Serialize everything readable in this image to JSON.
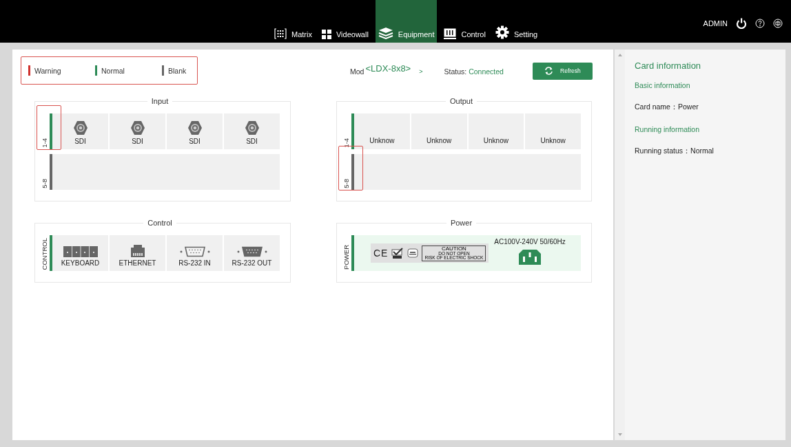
{
  "header": {
    "nav": [
      {
        "label": "Matrix",
        "selected": false
      },
      {
        "label": "Videowall",
        "selected": false
      },
      {
        "label": "Equipment",
        "selected": true
      },
      {
        "label": "Control",
        "selected": false
      },
      {
        "label": "Setting",
        "selected": false
      }
    ],
    "user": "ADMIN"
  },
  "legend": {
    "highlighted": true,
    "items": [
      {
        "label": "Warning",
        "color": "#d0312d"
      },
      {
        "label": "Normal",
        "color": "#2e8b57"
      },
      {
        "label": "Blank",
        "color": "#666666"
      }
    ]
  },
  "model": {
    "label": "Mod",
    "value": "<LDX-8x8>",
    "arrow": ">"
  },
  "status": {
    "label": "Status:",
    "value": "Connected"
  },
  "refresh_button": "Refresh",
  "groups": [
    {
      "title": "Input",
      "kind": "ports",
      "slots": [
        {
          "label": "1-4",
          "color": "#2e8b57",
          "highlighted": true,
          "ports": [
            {
              "label": "SDI",
              "kind": "sdi"
            },
            {
              "label": "SDI",
              "kind": "sdi"
            },
            {
              "label": "SDI",
              "kind": "sdi"
            },
            {
              "label": "SDI",
              "kind": "sdi"
            }
          ]
        },
        {
          "label": "5-8",
          "color": "#666666",
          "highlighted": false
        }
      ]
    },
    {
      "title": "Output",
      "kind": "ports",
      "slots": [
        {
          "label": "1-4",
          "color": "#2e8b57",
          "highlighted": false,
          "ports": [
            {
              "label": "Unknow",
              "kind": "text"
            },
            {
              "label": "Unknow",
              "kind": "text"
            },
            {
              "label": "Unknow",
              "kind": "text"
            },
            {
              "label": "Unknow",
              "kind": "text"
            }
          ]
        },
        {
          "label": "5-8",
          "color": "#666666",
          "highlighted": true
        }
      ]
    },
    {
      "title": "Control",
      "kind": "ports",
      "slots": [
        {
          "label": "CONTROL",
          "color": "#2e8b57",
          "highlighted": false,
          "ports": [
            {
              "label": "KEYBOARD",
              "kind": "keyboard"
            },
            {
              "label": "ETHERNET",
              "kind": "ethernet"
            },
            {
              "label": "RS-232 IN",
              "kind": "rs232-in"
            },
            {
              "label": "RS-232 OUT",
              "kind": "rs232-out"
            }
          ]
        }
      ]
    },
    {
      "title": "Power",
      "kind": "power",
      "slots": [
        {
          "label": "POWER",
          "color": "#2e8b57",
          "highlighted": false,
          "mark": "CE",
          "caution": [
            "CAUTION",
            "DO NOT OPEN",
            "RISK OF ELECTRIC SHOCK"
          ],
          "rating": "AC100V-240V 50/60Hz"
        }
      ]
    }
  ],
  "card_info": {
    "title": "Card information",
    "sections": [
      {
        "heading": "Basic information",
        "fields": [
          {
            "label": "Card name：",
            "value": "Power"
          }
        ]
      },
      {
        "heading": "Running information",
        "fields": [
          {
            "label": "Running status：",
            "value": "Normal"
          }
        ]
      }
    ]
  }
}
